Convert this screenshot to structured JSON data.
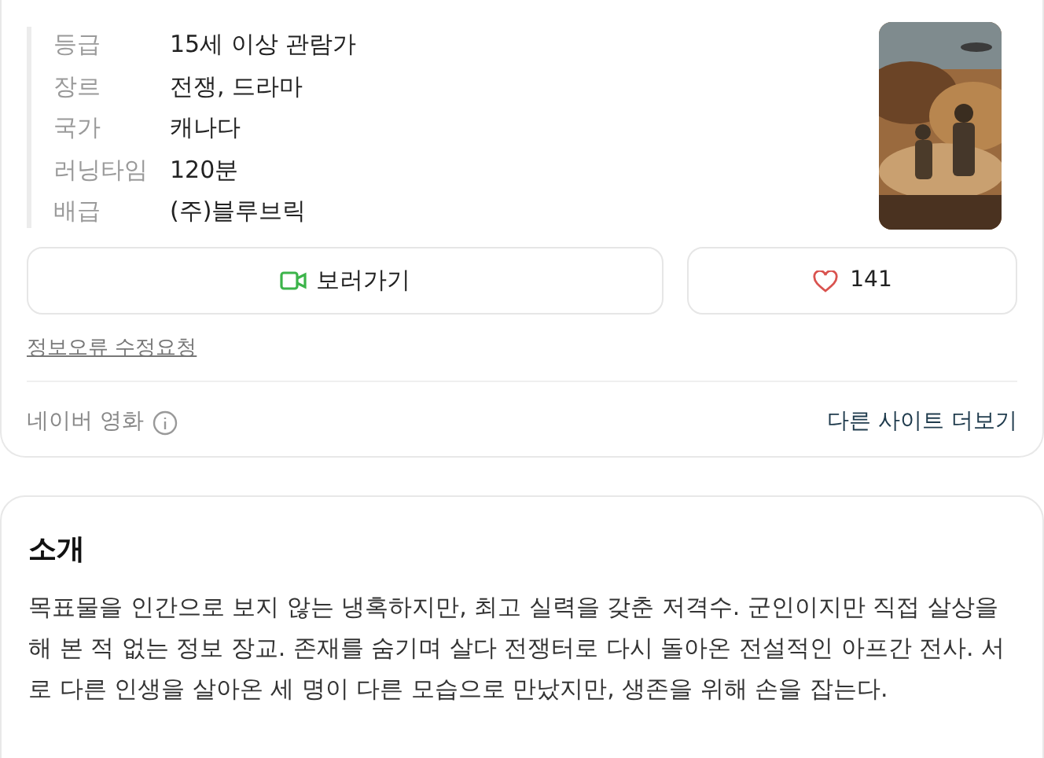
{
  "info": [
    {
      "label": "등급",
      "value": "15세 이상 관람가"
    },
    {
      "label": "장르",
      "value": "전쟁, 드라마"
    },
    {
      "label": "국가",
      "value": "캐나다"
    },
    {
      "label": "러닝타임",
      "value": "120분"
    },
    {
      "label": "배급",
      "value": "(주)블루브릭"
    }
  ],
  "watch_button": {
    "label": "보러가기"
  },
  "like_button": {
    "count": "141"
  },
  "report_link": "정보오류 수정요청",
  "footer": {
    "source": "네이버 영화",
    "more_link": "다른 사이트 더보기"
  },
  "intro": {
    "title": "소개",
    "text": "목표물을 인간으로 보지 않는 냉혹하지만, 최고 실력을 갖춘 저격수. 군인이지만 직접 살상을 해 본 적 없는 정보 장교. 존재를 숨기며 살다 전쟁터로 다시 돌아온 전설적인 아프간 전사. 서로 다른 인생을 살아온 세 명이 다른 모습으로 만났지만, 생존을 위해 손을 잡는다."
  }
}
